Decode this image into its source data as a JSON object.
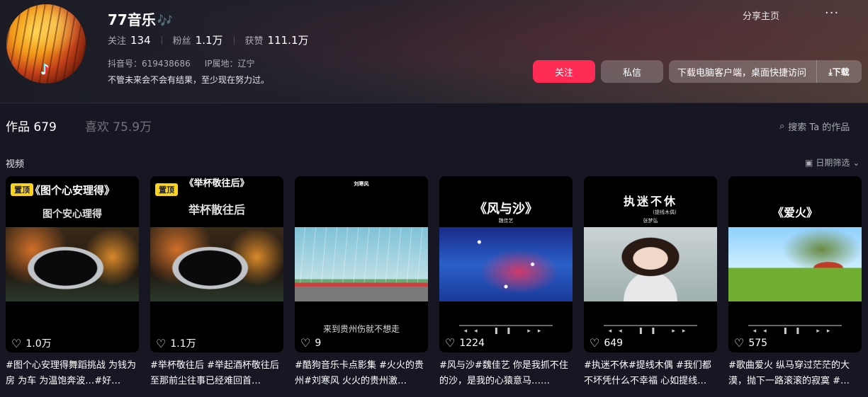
{
  "profile": {
    "name": "77音乐",
    "name_icon": "🎶",
    "follow_label": "关注",
    "follow_count": "134",
    "fans_label": "粉丝",
    "fans_count": "1.1万",
    "likes_label": "获赞",
    "likes_count": "111.1万",
    "douyin_id": "抖音号：619438686",
    "ip": "IP属地：辽宁",
    "bio": "不管未来会不会有结果，至少现在努力过。"
  },
  "header": {
    "share_label": "分享主页",
    "more_label": "···",
    "follow_button": "关注",
    "message_button": "私信",
    "download_text": "下载电脑客户端，桌面快捷访问",
    "download_button": "下载"
  },
  "tabs": [
    {
      "label": "作品",
      "count": "679"
    },
    {
      "label": "喜欢",
      "count": "75.9万"
    }
  ],
  "search_placeholder": "搜索 Ta 的作品",
  "section_label": "视频",
  "date_filter_label": "日期筛选",
  "videos": [
    {
      "pinned": "置顶",
      "thumb_title": "《图个心安理得》",
      "thumb_sub": "图个安心理得",
      "likes": "1.0万",
      "description": "#图个心安理得舞蹈挑战 为钱为房 为车 为温饱奔波…#好…"
    },
    {
      "pinned": "置顶",
      "thumb_title": "《举杯敬往后》",
      "thumb_sub": "举杯散往后",
      "likes": "1.1万",
      "description": "#举杯敬往后 #举起酒杯敬往后 至那前尘往事已经难回首…"
    },
    {
      "thumb_title": "刘寒风",
      "thumb_sub": "来到贵州伤就不想走",
      "likes": "9",
      "description": "#酷狗音乐卡点影集 #火火的贵州#刘寒风 火火的贵州激…"
    },
    {
      "thumb_title": "《风与沙》",
      "thumb_sub": "魏佳艺",
      "likes": "1224",
      "description": "#风与沙#魏佳艺 你是我抓不住的沙，是我的心猿意马……"
    },
    {
      "thumb_title": "执迷不休",
      "thumb_sub": "张梦弘",
      "thumb_tag": "(提线木偶)",
      "likes": "649",
      "description": "#执迷不休#提线木偶 #我们都不坏凭什么不幸福 心如提线…"
    },
    {
      "thumb_title": "《爱火》",
      "likes": "575",
      "description": "#歌曲爱火 纵马穿过茫茫的大漠，抛下一路滚滚的寂寞 #…"
    }
  ],
  "colors": {
    "accent": "#fe2c55",
    "background": "#161722",
    "pin": "#f8d51c"
  }
}
